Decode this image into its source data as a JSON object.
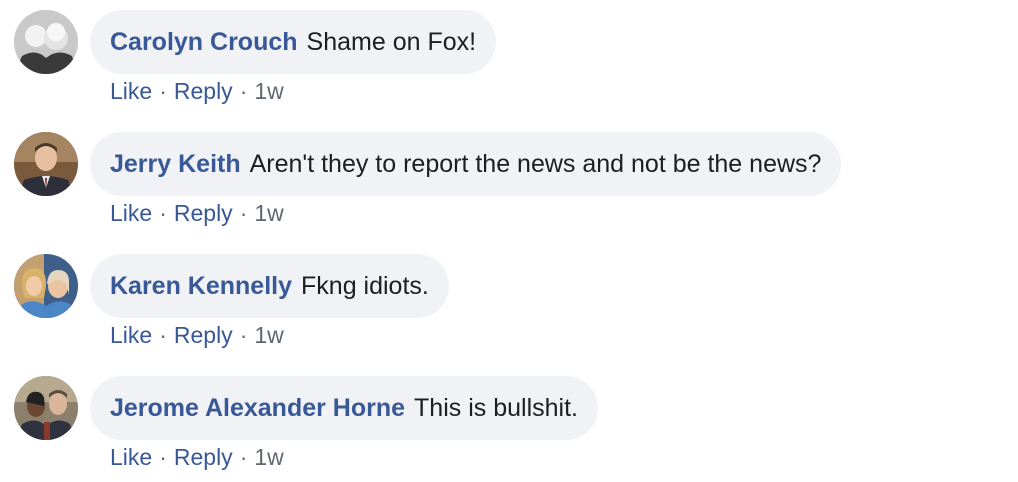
{
  "comments": [
    {
      "author": "Carolyn Crouch",
      "text": "Shame on Fox!",
      "like": "Like",
      "reply": "Reply",
      "time": "1w",
      "avatar_icon": "avatar-photo"
    },
    {
      "author": "Jerry Keith",
      "text": "Aren't they to report the news and not be the news?",
      "like": "Like",
      "reply": "Reply",
      "time": "1w",
      "avatar_icon": "avatar-photo"
    },
    {
      "author": "Karen Kennelly",
      "text": "Fkng idiots.",
      "like": "Like",
      "reply": "Reply",
      "time": "1w",
      "avatar_icon": "avatar-photo"
    },
    {
      "author": "Jerome Alexander Horne",
      "text": "This is bullshit.",
      "like": "Like",
      "reply": "Reply",
      "time": "1w",
      "avatar_icon": "avatar-photo"
    }
  ],
  "separator": "·",
  "colors": {
    "author": "#385898",
    "bubble": "#f0f2f5",
    "meta": "#606770",
    "text": "#1c1e21"
  }
}
